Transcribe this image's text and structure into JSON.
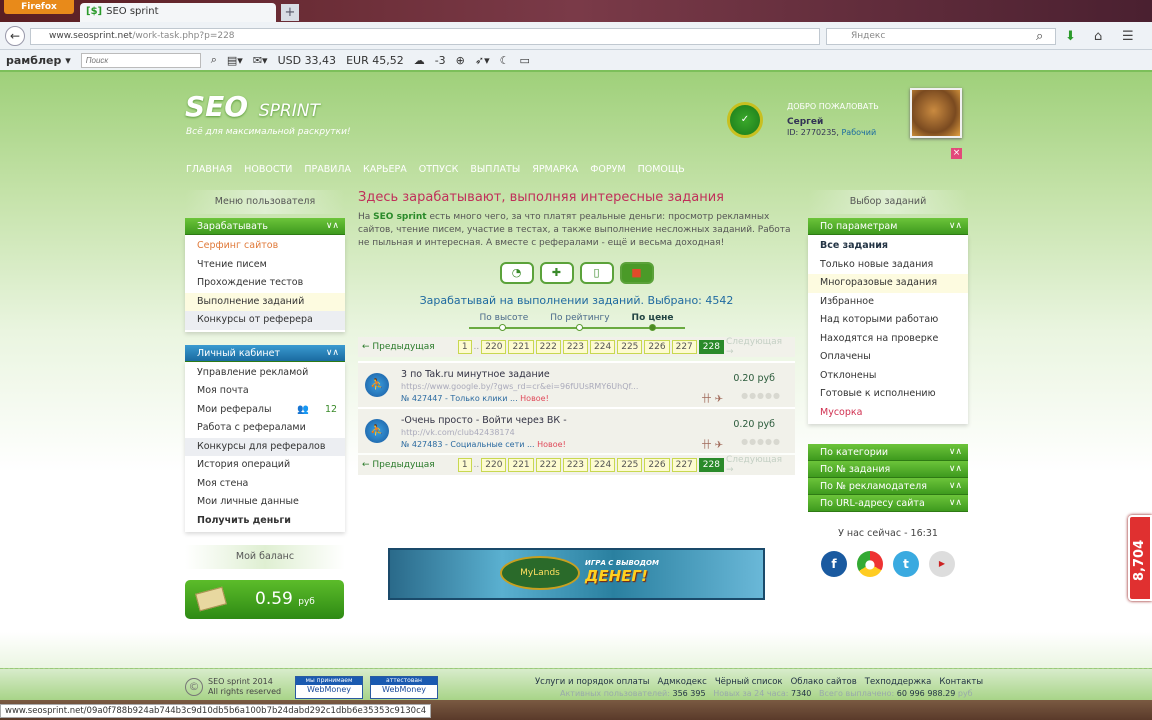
{
  "browser": {
    "menu_button": "Firefox",
    "tab_title": "SEO sprint",
    "new_tab": "+",
    "url_domain": "www.seosprint.net",
    "url_path": "/work-task.php?p=228",
    "search_engine": "Яндекс"
  },
  "toolbar": {
    "brand": "рамблер ▾",
    "search_placeholder": "Поиск",
    "usd": "USD 33,43",
    "eur": "EUR 45,52",
    "weather": "-3"
  },
  "header": {
    "logo": "SEO",
    "logo_sub": "SPRINT",
    "slogan": "Всё для максимальной раскрутки!",
    "welcome": "ДОБРО ПОЖАЛОВАТЬ",
    "user_name": "Сергей",
    "user_id": "ID: 2770235,",
    "user_status": "Рабочий",
    "close": "×"
  },
  "nav": [
    "ГЛАВНАЯ",
    "НОВОСТИ",
    "ПРАВИЛА",
    "КАРЬЕРА",
    "ОТПУСК",
    "ВЫПЛАТЫ",
    "ЯРМАРКА",
    "ФОРУМ",
    "ПОМОЩЬ"
  ],
  "left": {
    "title": "Меню пользователя",
    "earn_header": "Зарабатывать",
    "earn_items": [
      "Серфинг сайтов",
      "Чтение писем",
      "Прохождение тестов",
      "Выполнение заданий",
      "Конкурсы от реферера"
    ],
    "cabinet_header": "Личный кабинет",
    "cabinet_items": [
      "Управление рекламой",
      "Моя почта",
      "Мои рефералы",
      "Работа с рефералами",
      "Конкурсы для рефералов",
      "История операций",
      "Моя стена",
      "Мои личные данные",
      "Получить деньги"
    ],
    "referrals_count": "12",
    "balance_title": "Мой баланс",
    "balance": "0.59",
    "balance_unit": "руб"
  },
  "center": {
    "heading": "Здесь зарабатывают, выполняя интересные задания",
    "intro_pre": "На ",
    "intro_brand": "SEO sprint",
    "intro_text": " есть много чего, за что платят реальные деньги: просмотр рекламных сайтов, чтение писем, участие в тестах, а также выполнение несложных заданий. Работа не пыльная и интересная. А вместе с рефералами - ещё и весьма доходная!",
    "earn_line": "Зарабатывай на выполнении заданий. Выбрано: 4542",
    "sort": [
      "По высоте",
      "По рейтингу",
      "По цене"
    ],
    "prev": "← Предыдущая",
    "next": "Следующая →",
    "pages": [
      "1",
      "220",
      "221",
      "222",
      "223",
      "224",
      "225",
      "226",
      "227",
      "228"
    ],
    "current_page": "228",
    "tasks": [
      {
        "title": "3 по Tak.ru минутное задание",
        "url": "https://www.google.by/?gws_rd=cr&ei=96fUUsRMY6UhQf...",
        "meta": "№ 427447 - Только клики",
        "badge": "Новое!",
        "price": "0.20 руб"
      },
      {
        "title": "-Очень просто - Войти через ВК -",
        "url": "http://vk.com/club42438174",
        "meta": "№ 427483 - Социальные сети",
        "badge": "Новое!",
        "price": "0.20 руб"
      }
    ]
  },
  "right": {
    "title": "Выбор заданий",
    "params_header": "По параметрам",
    "param_items": [
      "Все задания",
      "Только новые задания",
      "Многоразовые задания",
      "Избранное",
      "Над которыми работаю",
      "Находятся на проверке",
      "Оплачены",
      "Отклонены",
      "Готовые к исполнению",
      "Мусорка"
    ],
    "filters": [
      "По категории",
      "По № задания",
      "По № рекламодателя",
      "По URL-адресу сайта"
    ],
    "clock": "У нас сейчас - 16:31"
  },
  "banner": {
    "logo": "MyLands",
    "line1": "ИГРА С ВЫВОДОМ",
    "line2": "ДЕНЕГ!"
  },
  "footer": {
    "copyright1": "SEO sprint 2014",
    "copyright2": "All rights reserved",
    "wm1_top": "мы принимаем",
    "wm2_top": "аттестован",
    "wm": "WebMoney",
    "links": [
      "Услуги и порядок оплаты",
      "Адмкодекс",
      "Чёрный список",
      "Облако сайтов",
      "Техподдержка",
      "Контакты"
    ],
    "active_label": "Активных пользователей:",
    "active": "356 395",
    "new_label": "Новых за 24 часа:",
    "new": "7340",
    "paid_label": "Всего выплачено:",
    "paid": "60 996 988.29",
    "paid_unit": "руб"
  },
  "status_url": "www.seosprint.net/09a0f788b924ab744b3c9d10db5b6a100b7b24dabd292c1dbb6e35353c9130c4",
  "counter": "8,704"
}
